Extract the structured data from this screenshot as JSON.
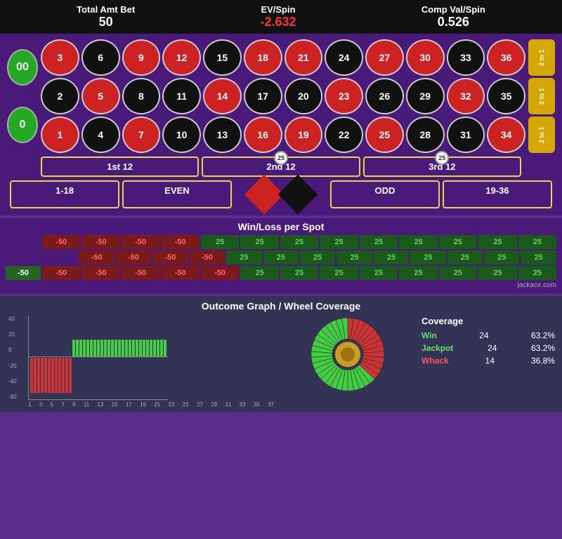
{
  "header": {
    "total_amt_label": "Total Amt Bet",
    "total_amt_value": "50",
    "ev_spin_label": "EV/Spin",
    "ev_spin_value": "-2.632",
    "comp_val_label": "Comp Val/Spin",
    "comp_val_value": "0.526"
  },
  "roulette": {
    "zeros": [
      "00",
      "0"
    ],
    "numbers": [
      {
        "n": "3",
        "c": "red"
      },
      {
        "n": "6",
        "c": "black"
      },
      {
        "n": "9",
        "c": "red"
      },
      {
        "n": "12",
        "c": "red"
      },
      {
        "n": "15",
        "c": "black"
      },
      {
        "n": "18",
        "c": "red"
      },
      {
        "n": "21",
        "c": "red"
      },
      {
        "n": "24",
        "c": "black"
      },
      {
        "n": "27",
        "c": "red"
      },
      {
        "n": "30",
        "c": "red"
      },
      {
        "n": "33",
        "c": "black"
      },
      {
        "n": "36",
        "c": "red"
      },
      {
        "n": "2",
        "c": "black"
      },
      {
        "n": "5",
        "c": "red"
      },
      {
        "n": "8",
        "c": "black"
      },
      {
        "n": "11",
        "c": "black"
      },
      {
        "n": "14",
        "c": "red"
      },
      {
        "n": "17",
        "c": "black"
      },
      {
        "n": "20",
        "c": "black"
      },
      {
        "n": "23",
        "c": "red"
      },
      {
        "n": "26",
        "c": "black"
      },
      {
        "n": "29",
        "c": "black"
      },
      {
        "n": "32",
        "c": "red"
      },
      {
        "n": "35",
        "c": "black"
      },
      {
        "n": "1",
        "c": "red"
      },
      {
        "n": "4",
        "c": "black"
      },
      {
        "n": "7",
        "c": "red"
      },
      {
        "n": "10",
        "c": "black"
      },
      {
        "n": "13",
        "c": "black"
      },
      {
        "n": "16",
        "c": "red"
      },
      {
        "n": "19",
        "c": "red"
      },
      {
        "n": "22",
        "c": "black"
      },
      {
        "n": "25",
        "c": "red"
      },
      {
        "n": "28",
        "c": "black"
      },
      {
        "n": "31",
        "c": "black"
      },
      {
        "n": "34",
        "c": "red"
      }
    ],
    "side_labels": [
      "2 to 1",
      "2 to 1",
      "2 to 1"
    ],
    "dozens": [
      "1st 12",
      "2nd 12",
      "3rd 12"
    ],
    "dozen_chips": [
      "",
      "25",
      "25"
    ],
    "evens": [
      "1-18",
      "EVEN",
      "ODD",
      "19-36"
    ]
  },
  "winloss": {
    "title": "Win/Loss per Spot",
    "rows": [
      [
        "-50",
        "-50",
        "-50",
        "-50",
        "25",
        "25",
        "25",
        "25",
        "25",
        "25",
        "25",
        "25",
        "25"
      ],
      [
        "",
        "-50",
        "-50",
        "-50",
        "-50",
        "25",
        "25",
        "25",
        "25",
        "25",
        "25",
        "25",
        "25",
        "25"
      ],
      [
        "-50",
        "-50",
        "-50",
        "-50",
        "-50",
        "25",
        "25",
        "25",
        "25",
        "25",
        "25",
        "25",
        "25"
      ]
    ],
    "credit": "jackace.com"
  },
  "outcome": {
    "title": "Outcome Graph / Wheel Coverage",
    "y_labels": [
      "40",
      "20",
      "0",
      "-20",
      "-40",
      "-60"
    ],
    "x_labels": [
      "1",
      "3",
      "5",
      "7",
      "9",
      "11",
      "13",
      "15",
      "17",
      "19",
      "21",
      "23",
      "25",
      "27",
      "29",
      "31",
      "33",
      "35",
      "37"
    ],
    "bars": [
      {
        "v": -50,
        "c": "red"
      },
      {
        "v": -50,
        "c": "red"
      },
      {
        "v": -50,
        "c": "red"
      },
      {
        "v": -50,
        "c": "red"
      },
      {
        "v": -50,
        "c": "red"
      },
      {
        "v": -50,
        "c": "red"
      },
      {
        "v": -50,
        "c": "red"
      },
      {
        "v": -50,
        "c": "red"
      },
      {
        "v": -50,
        "c": "red"
      },
      {
        "v": -50,
        "c": "red"
      },
      {
        "v": -50,
        "c": "red"
      },
      {
        "v": -50,
        "c": "red"
      },
      {
        "v": 25,
        "c": "green"
      },
      {
        "v": 25,
        "c": "green"
      },
      {
        "v": 25,
        "c": "green"
      },
      {
        "v": 25,
        "c": "green"
      },
      {
        "v": 25,
        "c": "green"
      },
      {
        "v": 25,
        "c": "green"
      },
      {
        "v": 25,
        "c": "green"
      },
      {
        "v": 25,
        "c": "green"
      },
      {
        "v": 25,
        "c": "green"
      },
      {
        "v": 25,
        "c": "green"
      },
      {
        "v": 25,
        "c": "green"
      },
      {
        "v": 25,
        "c": "green"
      },
      {
        "v": 25,
        "c": "green"
      },
      {
        "v": 25,
        "c": "green"
      },
      {
        "v": 25,
        "c": "green"
      },
      {
        "v": 25,
        "c": "green"
      },
      {
        "v": 25,
        "c": "green"
      },
      {
        "v": 25,
        "c": "green"
      },
      {
        "v": 25,
        "c": "green"
      },
      {
        "v": 25,
        "c": "green"
      },
      {
        "v": 25,
        "c": "green"
      },
      {
        "v": 25,
        "c": "green"
      },
      {
        "v": 25,
        "c": "green"
      },
      {
        "v": 25,
        "c": "green"
      },
      {
        "v": 25,
        "c": "green"
      },
      {
        "v": 25,
        "c": "green"
      },
      {
        "v": 25,
        "c": "green"
      }
    ],
    "coverage": {
      "title": "Coverage",
      "win_label": "Win",
      "win_count": "24",
      "win_pct": "63.2%",
      "jackpot_label": "Jackpot",
      "jackpot_count": "24",
      "jackpot_pct": "63.2%",
      "whack_label": "Whack",
      "whack_count": "14",
      "whack_pct": "36.8%"
    }
  }
}
